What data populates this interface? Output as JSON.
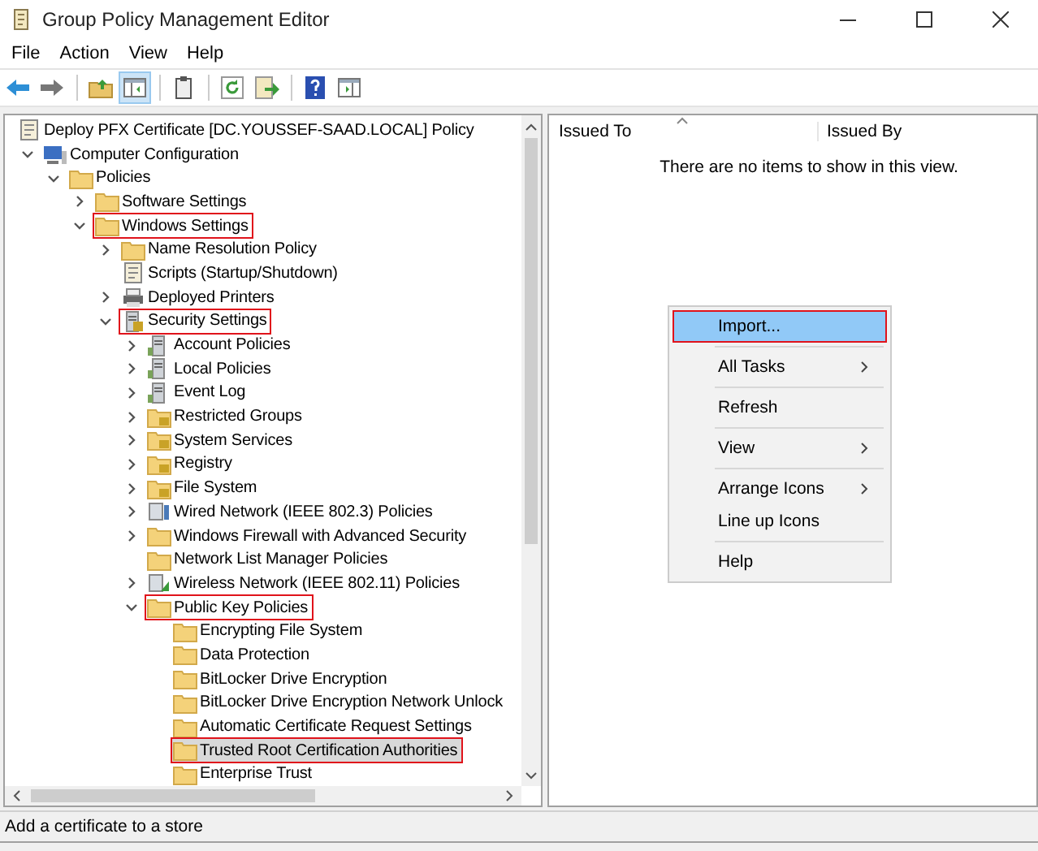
{
  "window": {
    "title": "Group Policy Management Editor"
  },
  "menu_bar": [
    "File",
    "Action",
    "View",
    "Help"
  ],
  "toolbar": [
    [
      {
        "kind": "back",
        "pressed": false
      },
      {
        "kind": "forward",
        "pressed": false
      }
    ],
    [
      {
        "kind": "up",
        "pressed": false
      },
      {
        "kind": "tree",
        "pressed": true
      }
    ],
    [
      {
        "kind": "properties",
        "pressed": false
      }
    ],
    [
      {
        "kind": "refresh",
        "pressed": false
      },
      {
        "kind": "export",
        "pressed": false
      }
    ],
    [
      {
        "kind": "help",
        "pressed": false
      },
      {
        "kind": "pane",
        "pressed": false
      }
    ]
  ],
  "tree": {
    "label": "Deploy PFX Certificate [DC.YOUSSEF-SAAD.LOCAL] Policy",
    "kind": "scroll",
    "selected": false,
    "outlined": false,
    "children": [
      {
        "label": "Computer Configuration",
        "kind": "computer",
        "expanded": true,
        "selected": false,
        "outlined": false,
        "children": [
          {
            "label": "Policies",
            "kind": "folder",
            "expanded": true,
            "selected": false,
            "outlined": false,
            "children": [
              {
                "label": "Software Settings",
                "kind": "folder",
                "expanded": false,
                "selected": false,
                "outlined": false
              },
              {
                "label": "Windows Settings",
                "kind": "folder",
                "expanded": true,
                "selected": false,
                "outlined": true,
                "children": [
                  {
                    "label": "Name Resolution Policy",
                    "kind": "folder",
                    "expanded": false,
                    "selected": false,
                    "outlined": false
                  },
                  {
                    "label": "Scripts (Startup/Shutdown)",
                    "kind": "scroll",
                    "selected": false,
                    "outlined": false
                  },
                  {
                    "label": "Deployed Printers",
                    "kind": "printer",
                    "expanded": false,
                    "selected": false,
                    "outlined": false
                  },
                  {
                    "label": "Security Settings",
                    "kind": "lockserver",
                    "expanded": true,
                    "selected": false,
                    "outlined": true,
                    "children": [
                      {
                        "label": "Account Policies",
                        "kind": "server",
                        "expanded": false,
                        "selected": false,
                        "outlined": false
                      },
                      {
                        "label": "Local Policies",
                        "kind": "server",
                        "expanded": false,
                        "selected": false,
                        "outlined": false
                      },
                      {
                        "label": "Event Log",
                        "kind": "server",
                        "expanded": false,
                        "selected": false,
                        "outlined": false
                      },
                      {
                        "label": "Restricted Groups",
                        "kind": "lockfolder",
                        "expanded": false,
                        "selected": false,
                        "outlined": false
                      },
                      {
                        "label": "System Services",
                        "kind": "lockfolder",
                        "expanded": false,
                        "selected": false,
                        "outlined": false
                      },
                      {
                        "label": "Registry",
                        "kind": "lockfolder",
                        "expanded": false,
                        "selected": false,
                        "outlined": false
                      },
                      {
                        "label": "File System",
                        "kind": "lockfolder",
                        "expanded": false,
                        "selected": false,
                        "outlined": false
                      },
                      {
                        "label": "Wired Network (IEEE 802.3) Policies",
                        "kind": "network",
                        "expanded": false,
                        "selected": false,
                        "outlined": false
                      },
                      {
                        "label": "Windows Firewall with Advanced Security",
                        "kind": "folder",
                        "expanded": false,
                        "selected": false,
                        "outlined": false
                      },
                      {
                        "label": "Network List Manager Policies",
                        "kind": "folder",
                        "selected": false,
                        "outlined": false
                      },
                      {
                        "label": "Wireless Network (IEEE 802.11) Policies",
                        "kind": "wireless",
                        "expanded": false,
                        "selected": false,
                        "outlined": false
                      },
                      {
                        "label": "Public Key Policies",
                        "kind": "folder",
                        "expanded": true,
                        "selected": false,
                        "outlined": true,
                        "children": [
                          {
                            "label": "Encrypting File System",
                            "kind": "folder",
                            "selected": false,
                            "outlined": false
                          },
                          {
                            "label": "Data Protection",
                            "kind": "folder",
                            "selected": false,
                            "outlined": false
                          },
                          {
                            "label": "BitLocker Drive Encryption",
                            "kind": "folder",
                            "selected": false,
                            "outlined": false
                          },
                          {
                            "label": "BitLocker Drive Encryption Network Unlock",
                            "kind": "folder",
                            "selected": false,
                            "outlined": false
                          },
                          {
                            "label": "Automatic Certificate Request Settings",
                            "kind": "folder",
                            "selected": false,
                            "outlined": false
                          },
                          {
                            "label": "Trusted Root Certification Authorities",
                            "kind": "folder",
                            "selected": true,
                            "outlined": true
                          },
                          {
                            "label": "Enterprise Trust",
                            "kind": "folder",
                            "selected": false,
                            "outlined": false
                          }
                        ]
                      }
                    ]
                  }
                ]
              }
            ]
          }
        ]
      }
    ]
  },
  "list": {
    "columns": [
      "Issued To",
      "Issued By"
    ],
    "empty_message": "There are no items to show in this view."
  },
  "context_menu": [
    [
      {
        "label": "Import...",
        "selected": true,
        "outlined": true,
        "submenu": false
      }
    ],
    [
      {
        "label": "All Tasks",
        "selected": false,
        "outlined": false,
        "submenu": true
      }
    ],
    [
      {
        "label": "Refresh",
        "selected": false,
        "outlined": false,
        "submenu": false
      }
    ],
    [
      {
        "label": "View",
        "selected": false,
        "outlined": false,
        "submenu": true
      }
    ],
    [
      {
        "label": "Arrange Icons",
        "selected": false,
        "outlined": false,
        "submenu": true
      },
      {
        "label": "Line up Icons",
        "selected": false,
        "outlined": false,
        "submenu": false
      }
    ],
    [
      {
        "label": "Help",
        "selected": false,
        "outlined": false,
        "submenu": false
      }
    ]
  ],
  "status_bar": "Add a certificate to a store"
}
